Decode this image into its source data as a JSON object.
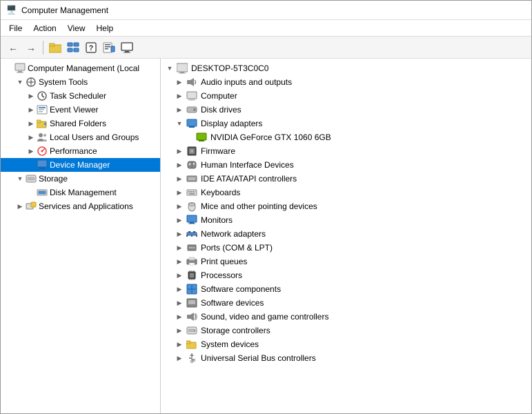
{
  "window": {
    "title": "Computer Management",
    "titleIcon": "🖥️"
  },
  "menuBar": {
    "items": [
      {
        "id": "file",
        "label": "File"
      },
      {
        "id": "action",
        "label": "Action"
      },
      {
        "id": "view",
        "label": "View"
      },
      {
        "id": "help",
        "label": "Help"
      }
    ]
  },
  "toolbar": {
    "buttons": [
      {
        "id": "back",
        "icon": "←"
      },
      {
        "id": "forward",
        "icon": "→"
      },
      {
        "id": "up",
        "icon": "📁"
      },
      {
        "id": "show-hide",
        "icon": "🗂"
      },
      {
        "id": "help",
        "icon": "❓"
      },
      {
        "id": "properties",
        "icon": "📋"
      },
      {
        "id": "monitor",
        "icon": "🖥"
      }
    ]
  },
  "leftPanel": {
    "items": [
      {
        "id": "computer-management",
        "label": "Computer Management (Local",
        "icon": "🖥️",
        "level": 1,
        "expanded": true,
        "expandChar": ""
      },
      {
        "id": "system-tools",
        "label": "System Tools",
        "icon": "🔧",
        "level": 2,
        "expanded": true,
        "expandChar": "▼"
      },
      {
        "id": "task-scheduler",
        "label": "Task Scheduler",
        "icon": "📅",
        "level": 3,
        "expandChar": "▶"
      },
      {
        "id": "event-viewer",
        "label": "Event Viewer",
        "icon": "📊",
        "level": 3,
        "expandChar": "▶"
      },
      {
        "id": "shared-folders",
        "label": "Shared Folders",
        "icon": "📂",
        "level": 3,
        "expandChar": "▶"
      },
      {
        "id": "local-users",
        "label": "Local Users and Groups",
        "icon": "👥",
        "level": 3,
        "expandChar": "▶"
      },
      {
        "id": "performance",
        "label": "Performance",
        "icon": "📈",
        "level": 3,
        "expandChar": "▶"
      },
      {
        "id": "device-manager",
        "label": "Device Manager",
        "icon": "🖥",
        "level": 3,
        "expandChar": "",
        "selected": true
      },
      {
        "id": "storage",
        "label": "Storage",
        "icon": "💾",
        "level": 2,
        "expanded": true,
        "expandChar": "▼"
      },
      {
        "id": "disk-management",
        "label": "Disk Management",
        "icon": "🗜",
        "level": 3,
        "expandChar": ""
      },
      {
        "id": "services-apps",
        "label": "Services and Applications",
        "icon": "⚙️",
        "level": 2,
        "expandChar": "▶"
      }
    ]
  },
  "rightPanel": {
    "header": "DESKTOP-5T3C0C0",
    "items": [
      {
        "id": "audio",
        "label": "Audio inputs and outputs",
        "icon": "🔊",
        "level": 1,
        "expandChar": "▶",
        "expanded": false
      },
      {
        "id": "computer",
        "label": "Computer",
        "icon": "💻",
        "level": 1,
        "expandChar": "▶",
        "expanded": false
      },
      {
        "id": "disk-drives",
        "label": "Disk drives",
        "icon": "💾",
        "level": 1,
        "expandChar": "▶",
        "expanded": false
      },
      {
        "id": "display-adapters",
        "label": "Display adapters",
        "icon": "🖥",
        "level": 1,
        "expandChar": "▼",
        "expanded": true
      },
      {
        "id": "nvidia",
        "label": "NVIDIA GeForce GTX 1060 6GB",
        "icon": "🖥",
        "level": 2,
        "expandChar": "",
        "expanded": false
      },
      {
        "id": "firmware",
        "label": "Firmware",
        "icon": "📋",
        "level": 1,
        "expandChar": "▶",
        "expanded": false
      },
      {
        "id": "human-interface",
        "label": "Human Interface Devices",
        "icon": "🎮",
        "level": 1,
        "expandChar": "▶",
        "expanded": false
      },
      {
        "id": "ide",
        "label": "IDE ATA/ATAPI controllers",
        "icon": "🔌",
        "level": 1,
        "expandChar": "▶",
        "expanded": false
      },
      {
        "id": "keyboards",
        "label": "Keyboards",
        "icon": "⌨️",
        "level": 1,
        "expandChar": "▶",
        "expanded": false
      },
      {
        "id": "mice",
        "label": "Mice and other pointing devices",
        "icon": "🖱",
        "level": 1,
        "expandChar": "▶",
        "expanded": false
      },
      {
        "id": "monitors",
        "label": "Monitors",
        "icon": "🖥",
        "level": 1,
        "expandChar": "▶",
        "expanded": false
      },
      {
        "id": "network-adapters",
        "label": "Network adapters",
        "icon": "🌐",
        "level": 1,
        "expandChar": "▶",
        "expanded": false
      },
      {
        "id": "ports",
        "label": "Ports (COM & LPT)",
        "icon": "🖨",
        "level": 1,
        "expandChar": "▶",
        "expanded": false
      },
      {
        "id": "print-queues",
        "label": "Print queues",
        "icon": "🖨",
        "level": 1,
        "expandChar": "▶",
        "expanded": false
      },
      {
        "id": "processors",
        "label": "Processors",
        "icon": "⬛",
        "level": 1,
        "expandChar": "▶",
        "expanded": false
      },
      {
        "id": "software-components",
        "label": "Software components",
        "icon": "📦",
        "level": 1,
        "expandChar": "▶",
        "expanded": false
      },
      {
        "id": "software-devices",
        "label": "Software devices",
        "icon": "📄",
        "level": 1,
        "expandChar": "▶",
        "expanded": false
      },
      {
        "id": "sound",
        "label": "Sound, video and game controllers",
        "icon": "🔊",
        "level": 1,
        "expandChar": "▶",
        "expanded": false
      },
      {
        "id": "storage-controllers",
        "label": "Storage controllers",
        "icon": "💾",
        "level": 1,
        "expandChar": "▶",
        "expanded": false
      },
      {
        "id": "system-devices",
        "label": "System devices",
        "icon": "📁",
        "level": 1,
        "expandChar": "▶",
        "expanded": false
      },
      {
        "id": "usb",
        "label": "Universal Serial Bus controllers",
        "icon": "🔌",
        "level": 1,
        "expandChar": "▶",
        "expanded": false
      }
    ]
  }
}
